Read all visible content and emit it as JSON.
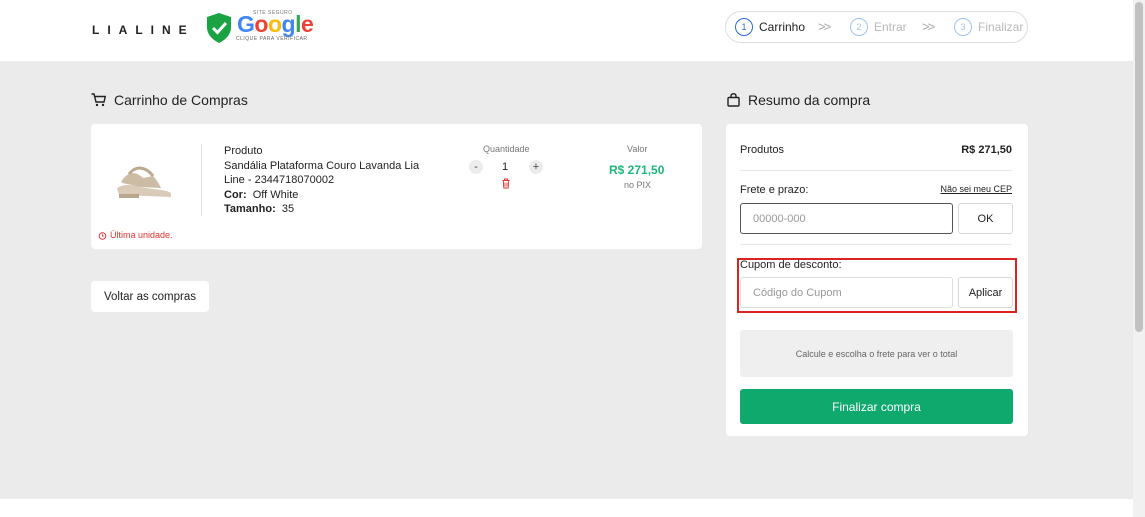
{
  "header": {
    "logo": "LIALINE",
    "badge": {
      "top_text": "SITE SEGURO",
      "brand": "Google",
      "sub_text": "CLIQUE PARA VERIFICAR"
    },
    "steps": [
      {
        "num": "1",
        "label": "Carrinho"
      },
      {
        "num": "2",
        "label": "Entrar"
      },
      {
        "num": "3",
        "label": "Finalizar"
      }
    ]
  },
  "cart": {
    "title": "Carrinho de Compras",
    "product": {
      "heading": "Produto",
      "name": "Sandália Plataforma Couro Lavanda Lia Line - 2344718070002",
      "color_label": "Cor:",
      "color_value": "Off White",
      "size_label": "Tamanho:",
      "size_value": "35",
      "warning": "Última unidade.",
      "quantity_label": "Quantidade",
      "quantity": "1",
      "value_label": "Valor",
      "price": "R$ 271,50",
      "price_note": "no PIX"
    },
    "back_button": "Voltar as compras"
  },
  "summary": {
    "title": "Resumo da compra",
    "products_label": "Produtos",
    "products_value": "R$ 271,50",
    "shipping_label": "Frete e prazo:",
    "cep_link": "Não sei meu CEP",
    "cep_placeholder": "00000-000",
    "ok_button": "OK",
    "coupon_label": "Cupom de desconto:",
    "coupon_placeholder": "Código do Cupom",
    "apply_button": "Aplicar",
    "calc_note": "Calcule e escolha o frete para ver o total",
    "finalize_button": "Finalizar compra"
  },
  "colors": {
    "accent_green": "#0fa86d",
    "price_green": "#1db879",
    "step_blue": "#2f6bd8",
    "warning_red": "#e23232",
    "highlight_red": "#dd2222"
  }
}
